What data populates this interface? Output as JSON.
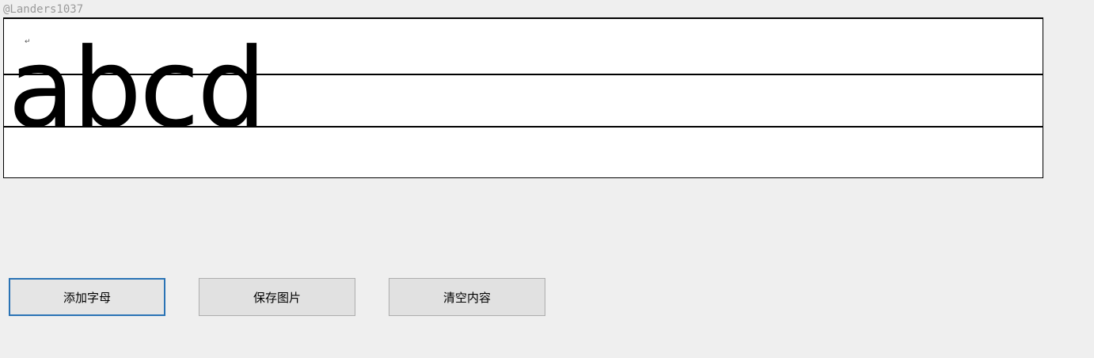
{
  "watermark": "@Landers1037",
  "canvas": {
    "return_mark": "↵",
    "letters": "abcd"
  },
  "buttons": {
    "add_letter": "添加字母",
    "save_image": "保存图片",
    "clear_content": "清空内容"
  },
  "colors": {
    "window_bg": "#efefef",
    "canvas_bg": "#ffffff",
    "focus_border": "#2a73b5",
    "button_bg": "#e1e1e1"
  }
}
